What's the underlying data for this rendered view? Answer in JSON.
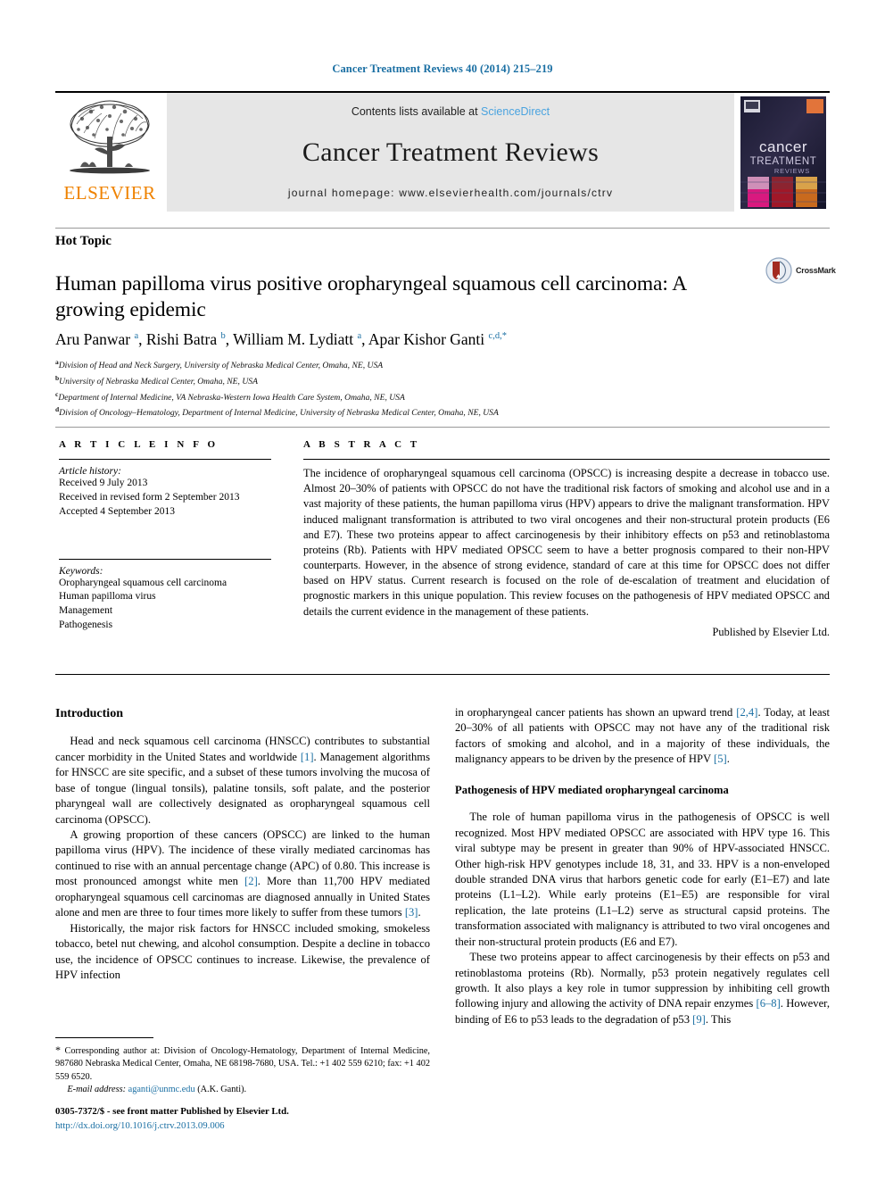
{
  "running_head": "Cancer Treatment Reviews 40 (2014) 215–219",
  "masthead": {
    "publisher_name": "ELSEVIER",
    "contents_prefix": "Contents lists available at ",
    "sciencedirect": "ScienceDirect",
    "journal_title": "Cancer Treatment Reviews",
    "homepage": "journal homepage: www.elsevierhealth.com/journals/ctrv",
    "cover_title_1": "cancer",
    "cover_title_2": "TREATMENT",
    "cover_title_3": "REVIEWS"
  },
  "article": {
    "section_label": "Hot Topic",
    "title": "Human papilloma virus positive oropharyngeal squamous cell carcinoma: A growing epidemic",
    "crossmark_label": "CrossMark",
    "authors_html": "Aru Panwar <sup>a</sup>, Rishi Batra <sup>b</sup>, William M. Lydiatt <sup>a</sup>, Apar Kishor Ganti <sup>c,d,</sup><sup>*</sup>",
    "affiliations": [
      {
        "mark": "a",
        "text": "Division of Head and Neck Surgery, University of Nebraska Medical Center, Omaha, NE, USA"
      },
      {
        "mark": "b",
        "text": "University of Nebraska Medical Center, Omaha, NE, USA"
      },
      {
        "mark": "c",
        "text": "Department of Internal Medicine, VA Nebraska-Western Iowa Health Care System, Omaha, NE, USA"
      },
      {
        "mark": "d",
        "text": "Division of Oncology–Hematology, Department of Internal Medicine, University of Nebraska Medical Center, Omaha, NE, USA"
      }
    ]
  },
  "article_info": {
    "heading": "A R T I C L E    I N F O",
    "history_heading": "Article history:",
    "history": [
      "Received 9 July 2013",
      "Received in revised form 2 September 2013",
      "Accepted 4 September 2013"
    ],
    "keywords_heading": "Keywords:",
    "keywords": [
      "Oropharyngeal squamous cell carcinoma",
      "Human papilloma virus",
      "Management",
      "Pathogenesis"
    ]
  },
  "abstract": {
    "heading": "A B S T R A C T",
    "text": "The incidence of oropharyngeal squamous cell carcinoma (OPSCC) is increasing despite a decrease in tobacco use. Almost 20–30% of patients with OPSCC do not have the traditional risk factors of smoking and alcohol use and in a vast majority of these patients, the human papilloma virus (HPV) appears to drive the malignant transformation. HPV induced malignant transformation is attributed to two viral oncogenes and their non-structural protein products (E6 and E7). These two proteins appear to affect carcinogenesis by their inhibitory effects on p53 and retinoblastoma proteins (Rb). Patients with HPV mediated OPSCC seem to have a better prognosis compared to their non-HPV counterparts. However, in the absence of strong evidence, standard of care at this time for OPSCC does not differ based on HPV status. Current research is focused on the role of de-escalation of treatment and elucidation of prognostic markers in this unique population. This review focuses on the pathogenesis of HPV mediated OPSCC and details the current evidence in the management of these patients.",
    "published_by": "Published by Elsevier Ltd."
  },
  "body": {
    "intro_heading": "Introduction",
    "intro_p1_html": "Head and neck squamous cell carcinoma (HNSCC) contributes to substantial cancer morbidity in the United States and worldwide <span class=\"ref\">[1]</span>. Management algorithms for HNSCC are site specific, and a subset of these tumors involving the mucosa of base of tongue (lingual tonsils), palatine tonsils, soft palate, and the posterior pharyngeal wall are collectively designated as oropharyngeal squamous cell carcinoma (OPSCC).",
    "intro_p2_html": "A growing proportion of these cancers (OPSCC) are linked to the human papilloma virus (HPV). The incidence of these virally mediated carcinomas has continued to rise with an annual percentage change (APC) of 0.80. This increase is most pronounced amongst white men <span class=\"ref\">[2]</span>. More than 11,700 HPV mediated oropharyngeal squamous cell carcinomas are diagnosed annually in United States alone and men are three to four times more likely to suffer from these tumors <span class=\"ref\">[3]</span>.",
    "intro_p3_html": "Historically, the major risk factors for HNSCC included smoking, smokeless tobacco, betel nut chewing, and alcohol consumption. Despite a decline in tobacco use, the incidence of OPSCC continues to increase. Likewise, the prevalence of HPV infection",
    "right_p1_html": "in oropharyngeal cancer patients has shown an upward trend <span class=\"ref\">[2,4]</span>. Today, at least 20–30% of all patients with OPSCC may not have any of the traditional risk factors of smoking and alcohol, and in a majority of these individuals, the malignancy appears to be driven by the presence of HPV <span class=\"ref\">[5]</span>.",
    "patho_heading": "Pathogenesis of HPV mediated oropharyngeal carcinoma",
    "patho_p1_html": "The role of human papilloma virus in the pathogenesis of OPSCC is well recognized. Most HPV mediated OPSCC are associated with HPV type 16. This viral subtype may be present in greater than 90% of HPV-associated HNSCC. Other high-risk HPV genotypes include 18, 31, and 33. HPV is a non-enveloped double stranded DNA virus that harbors genetic code for early (E1–E7) and late proteins (L1–L2). While early proteins (E1–E5) are responsible for viral replication, the late proteins (L1–L2) serve as structural capsid proteins. The transformation associated with malignancy is attributed to two viral oncogenes and their non-structural protein products (E6 and E7).",
    "patho_p2_html": "These two proteins appear to affect carcinogenesis by their effects on p53 and retinoblastoma proteins (Rb). Normally, p53 protein negatively regulates cell growth. It also plays a key role in tumor suppression by inhibiting cell growth following injury and allowing the activity of DNA repair enzymes <span class=\"ref\">[6–8]</span>. However, binding of E6 to p53 leads to the degradation of p53 <span class=\"ref\">[9]</span>. This"
  },
  "footnote": {
    "corresponding_html": "<span style=\"font-size:12px\">*</span> Corresponding author at: Division of Oncology-Hematology, Department of Internal Medicine, 987680 Nebraska Medical Center, Omaha, NE 68198-7680, USA. Tel.: +1 402 559 6210; fax: +1 402 559 6520.",
    "email_label": "E-mail address:",
    "email": "aganti@unmc.edu",
    "email_suffix": "(A.K. Ganti)."
  },
  "bottom": {
    "issn_line": "0305-7372/$ - see front matter Published by Elsevier Ltd.",
    "doi": "http://dx.doi.org/10.1016/j.ctrv.2013.09.006"
  },
  "colors": {
    "link_blue": "#1a6fa3",
    "sciencedirect_blue": "#4aa3df",
    "elsevier_orange": "#ef8200",
    "banner_gray": "#e6e6e6"
  }
}
